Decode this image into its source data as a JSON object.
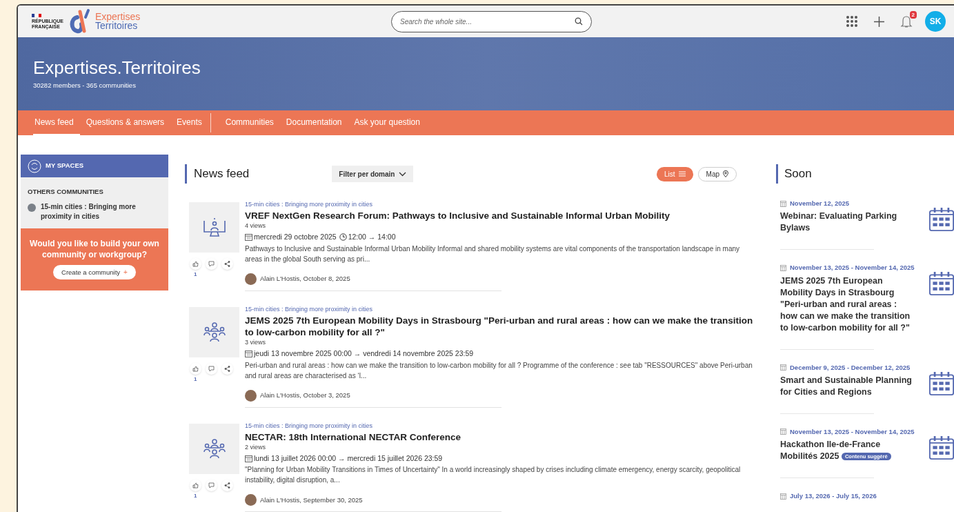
{
  "header": {
    "gov_line1": "RÉPUBLIQUE",
    "gov_line2": "FRANÇAISE",
    "brand_line1": "Expertises",
    "brand_line2": "Territoires",
    "search": {
      "placeholder": "Search the whole site..."
    },
    "notifications_count": "2",
    "avatar_initials": "SK"
  },
  "banner": {
    "title": "Expertises.Territoires",
    "subtitle": "30282 members - 365 communities"
  },
  "nav": {
    "primary": [
      {
        "label": "News feed",
        "selected": true
      },
      {
        "label": "Questions & answers",
        "selected": false
      },
      {
        "label": "Events",
        "selected": false
      }
    ],
    "secondary": [
      {
        "label": "Communities",
        "selected": false
      },
      {
        "label": "Documentation",
        "selected": false
      },
      {
        "label": "Ask your question",
        "selected": false
      }
    ]
  },
  "sidebar": {
    "header": "MY SPACES",
    "section_title": "OTHERS COMMUNITIES",
    "communities": [
      {
        "name": "15-min cities : Bringing more proximity in cities"
      }
    ],
    "promo": {
      "text": "Would you like to build your own community or workgroup?",
      "button": "Create a community",
      "button_icon": "+"
    }
  },
  "feed": {
    "title": "News feed",
    "filter": "Filter per domain",
    "views": [
      {
        "label": "List",
        "kind": "list",
        "selected": true
      },
      {
        "label": "Map",
        "kind": "map",
        "selected": false
      }
    ],
    "posts": [
      {
        "kind": "webinar",
        "community": "15-min cities : Bringing more proximity in cities",
        "title": "VREF NextGen Research Forum: Pathways to Inclusive and Sustainable Informal Urban Mobility",
        "views": "4 views",
        "date": "mercredi 29 octobre 2025",
        "time": "12:00 → 14:00",
        "excerpt": "Pathways to Inclusive and Sustainable Informal Urban Mobility Informal and shared mobility systems are vital components of the transportation landscape in many areas in the global South serving as pri...",
        "author": "Alain L'Hostis, October 8, 2025",
        "likes": "1"
      },
      {
        "kind": "meeting",
        "community": "15-min cities : Bringing more proximity in cities",
        "title": "JEMS 2025 7th European Mobility Days in Strasbourg \"Peri-urban and rural areas : how can we make the transition to low-carbon mobility for all ?\"",
        "views": "3 views",
        "date": "jeudi 13 novembre 2025 00:00 → vendredi 14 novembre 2025 23:59",
        "excerpt": "Peri-urban and rural areas : how can we make the transition to low-carbon mobility for all ? Programme of the conference : see tab \"RESSOURCES\" above Peri-urban and rural areas are characterised as ‘l...",
        "author": "Alain L'Hostis, October 3, 2025",
        "likes": "1"
      },
      {
        "kind": "meeting",
        "community": "15-min cities : Bringing more proximity in cities",
        "title": "NECTAR: 18th International NECTAR Conference",
        "views": "2 views",
        "date": "lundi 13 juillet 2026 00:00 → mercredi 15 juillet 2026 23:59",
        "excerpt": "\"Planning for Urban Mobility Transitions in Times of Uncertainty\" In a world increasingly shaped by crises including climate emergency, energy scarcity, geopolitical instability, digital disruption, a...",
        "author": "Alain L'Hostis, September 30, 2025",
        "likes": "1"
      }
    ]
  },
  "soon": {
    "title": "Soon",
    "events": [
      {
        "date": "November 12, 2025",
        "title": "Webinar: Evaluating Parking Bylaws"
      },
      {
        "date": "November 13, 2025 - November 14, 2025",
        "title": "JEMS 2025 7th European Mobility Days in Strasbourg \"Peri-urban and rural areas : how can we make the transition to low-carbon mobility for all ?\""
      },
      {
        "date": "December 9, 2025 - December 12, 2025",
        "title": "Smart and Sustainable Planning for Cities and Regions"
      },
      {
        "date": "November 13, 2025 - November 14, 2025",
        "title": "Hackathon Ile-de-France Mobilités 2025",
        "badge": "Contenu suggéré"
      },
      {
        "date": "July 13, 2026 - July 15, 2026"
      }
    ]
  }
}
